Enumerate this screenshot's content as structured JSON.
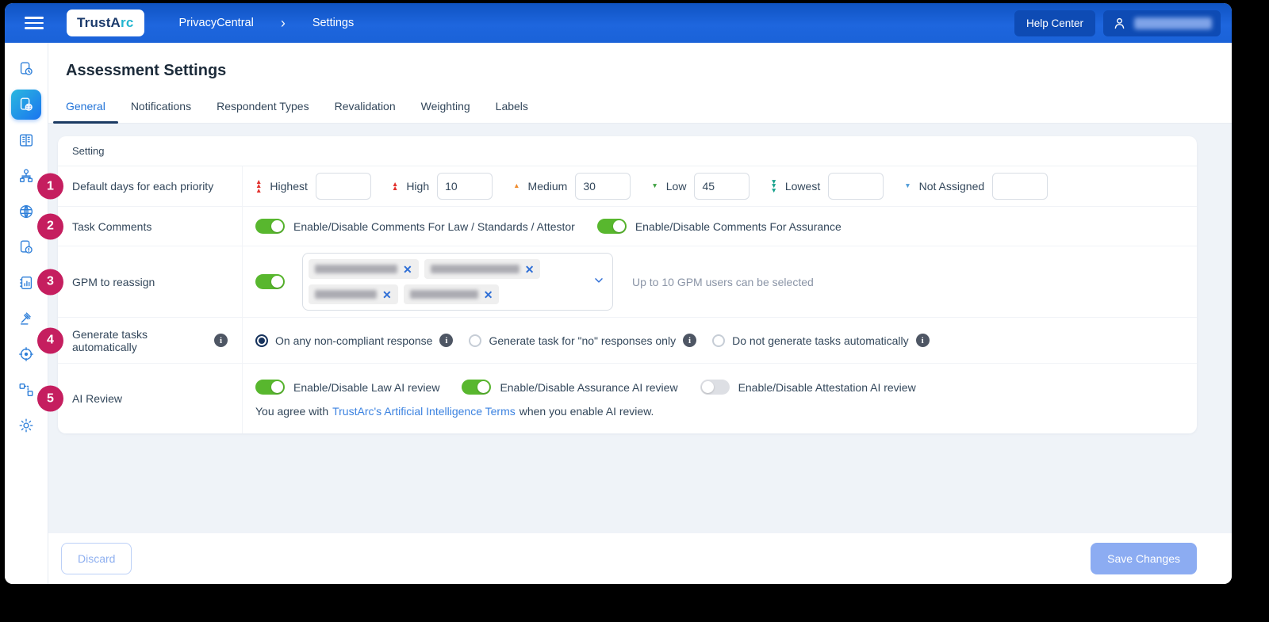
{
  "topbar": {
    "brand_primary": "TrustA",
    "brand_accent": "rc",
    "breadcrumb_app": "PrivacyCentral",
    "breadcrumb_sep": "›",
    "breadcrumb_page": "Settings",
    "help_button": "Help Center"
  },
  "sidebar": {
    "items": [
      {
        "icon": "document-clock-icon",
        "active": false
      },
      {
        "icon": "document-globe-icon",
        "active": true
      },
      {
        "icon": "table-columns-icon",
        "active": false
      },
      {
        "icon": "org-chart-icon",
        "active": false
      },
      {
        "icon": "brain-globe-icon",
        "active": false
      },
      {
        "icon": "document-alert-icon",
        "active": false
      },
      {
        "icon": "notebook-chart-icon",
        "active": false
      },
      {
        "icon": "gavel-icon",
        "active": false
      },
      {
        "icon": "target-icon",
        "active": false
      },
      {
        "icon": "flow-diagram-icon",
        "active": false
      },
      {
        "icon": "gear-icon",
        "active": false
      }
    ]
  },
  "page": {
    "title": "Assessment Settings"
  },
  "tabs": {
    "active": "General",
    "items": [
      {
        "label": "General"
      },
      {
        "label": "Notifications"
      },
      {
        "label": "Respondent Types"
      },
      {
        "label": "Revalidation"
      },
      {
        "label": "Weighting"
      },
      {
        "label": "Labels"
      }
    ]
  },
  "settings_table": {
    "header": "Setting",
    "rows": {
      "priority_days": {
        "number": "1",
        "label": "Default days for each priority",
        "priorities": [
          {
            "label": "Highest",
            "value": "",
            "icon": "priority-highest-icon",
            "glyph": "▲▲▲",
            "color": "#E2322E"
          },
          {
            "label": "High",
            "value": "10",
            "icon": "priority-high-icon",
            "glyph": "▲▲",
            "color": "#E2322E"
          },
          {
            "label": "Medium",
            "value": "30",
            "icon": "priority-medium-icon",
            "glyph": "▲",
            "color": "#F08C2D"
          },
          {
            "label": "Low",
            "value": "45",
            "icon": "priority-low-icon",
            "glyph": "▼",
            "color": "#3FA142"
          },
          {
            "label": "Lowest",
            "value": "",
            "icon": "priority-lowest-icon",
            "glyph": "▼▼▼",
            "color": "#17A18C"
          },
          {
            "label": "Not Assigned",
            "value": "",
            "icon": "priority-not-assigned-icon",
            "glyph": "▼",
            "color": "#4D9BD8"
          }
        ]
      },
      "task_comments": {
        "number": "2",
        "label": "Task Comments",
        "toggles": [
          {
            "label": "Enable/Disable Comments For Law / Standards / Attestor",
            "state": "on"
          },
          {
            "label": "Enable/Disable Comments For Assurance",
            "state": "on"
          }
        ]
      },
      "gpm_reassign": {
        "number": "3",
        "label": "GPM to reassign",
        "toggle_state": "on",
        "selected_chip_count": 4,
        "chip_remove_glyph": "✕",
        "helper": "Up to 10 GPM users can be selected"
      },
      "generate_tasks": {
        "number": "4",
        "label": "Generate tasks automatically",
        "options": [
          {
            "label": "On any non-compliant response",
            "selected": true
          },
          {
            "label": "Generate task for \"no\" responses only",
            "selected": false
          },
          {
            "label": "Do not generate tasks automatically",
            "selected": false
          }
        ],
        "info_glyph": "i"
      },
      "ai_review": {
        "number": "5",
        "label": "AI Review",
        "toggles": [
          {
            "label": "Enable/Disable Law AI review",
            "state": "on"
          },
          {
            "label": "Enable/Disable Assurance AI review",
            "state": "on"
          },
          {
            "label": "Enable/Disable Attestation AI review",
            "state": "off"
          }
        ],
        "agreement_prefix": "You agree with",
        "agreement_link": "TrustArc's Artificial Intelligence Terms",
        "agreement_suffix": "when you enable AI review."
      }
    }
  },
  "footer": {
    "discard": "Discard",
    "save": "Save Changes"
  },
  "colors": {
    "topbar_blue": "#1A62D8",
    "accent_blue": "#2173D8",
    "tab_indicator_navy": "#1B3A63",
    "toggle_green": "#58B72E",
    "badge_pink": "#C51E5F",
    "link_blue": "#3B82E0",
    "background": "#EFF3F8",
    "save_button_blue": "#8CACF2"
  }
}
